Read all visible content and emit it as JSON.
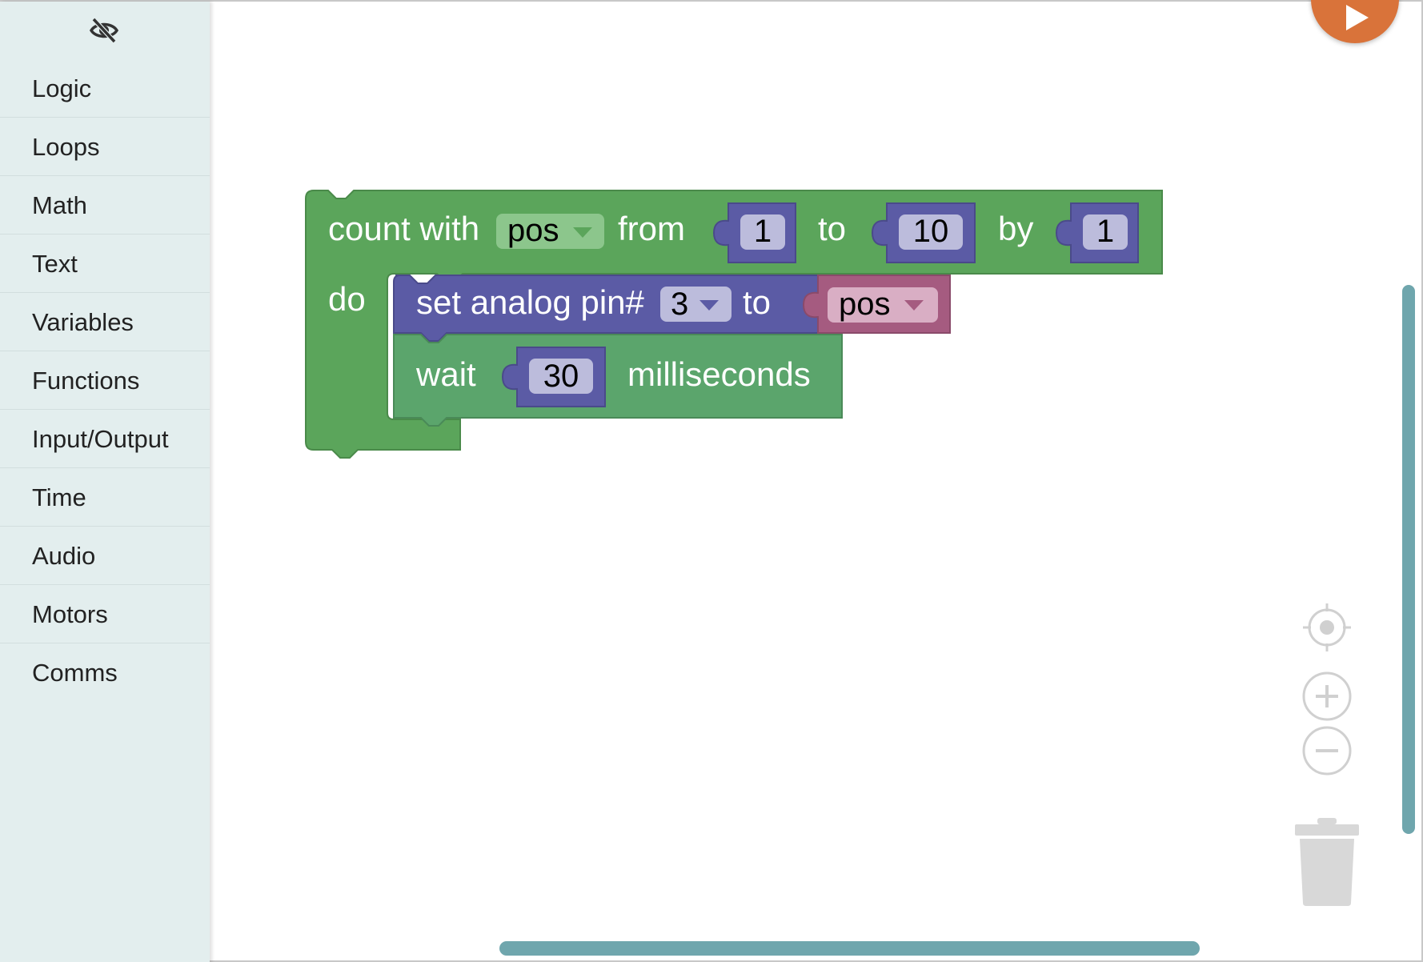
{
  "toolbox": {
    "toggle_icon": "eye-off-icon",
    "categories": [
      {
        "label": "Logic"
      },
      {
        "label": "Loops"
      },
      {
        "label": "Math"
      },
      {
        "label": "Text"
      },
      {
        "label": "Variables"
      },
      {
        "label": "Functions"
      },
      {
        "label": "Input/Output"
      },
      {
        "label": "Time"
      },
      {
        "label": "Audio"
      },
      {
        "label": "Motors"
      },
      {
        "label": "Comms"
      }
    ]
  },
  "workspace": {
    "loop_block": {
      "label_count_with": "count with",
      "variable": "pos",
      "label_from": "from",
      "from_value": "1",
      "label_to": "to",
      "to_value": "10",
      "label_by": "by",
      "by_value": "1",
      "label_do": "do"
    },
    "analog_block": {
      "label": "set analog pin#",
      "pin": "3",
      "label_to": "to",
      "value_variable": "pos"
    },
    "wait_block": {
      "label_wait": "wait",
      "duration": "30",
      "label_unit": "milliseconds"
    },
    "controls": {
      "recenter_icon": "crosshair-icon",
      "zoom_in_icon": "zoom-in-icon",
      "zoom_out_icon": "zoom-out-icon",
      "trash_icon": "trash-icon",
      "run_icon": "play-icon"
    }
  },
  "colors": {
    "loops_green": "#5ba55b",
    "math_blue": "#5b5ba5",
    "variable_pink": "#a55b80",
    "time_green": "#5ba56c",
    "run_orange": "#d9733a",
    "scrollbar": "#6fa6ad",
    "toolbox_bg": "#e3eeee"
  }
}
